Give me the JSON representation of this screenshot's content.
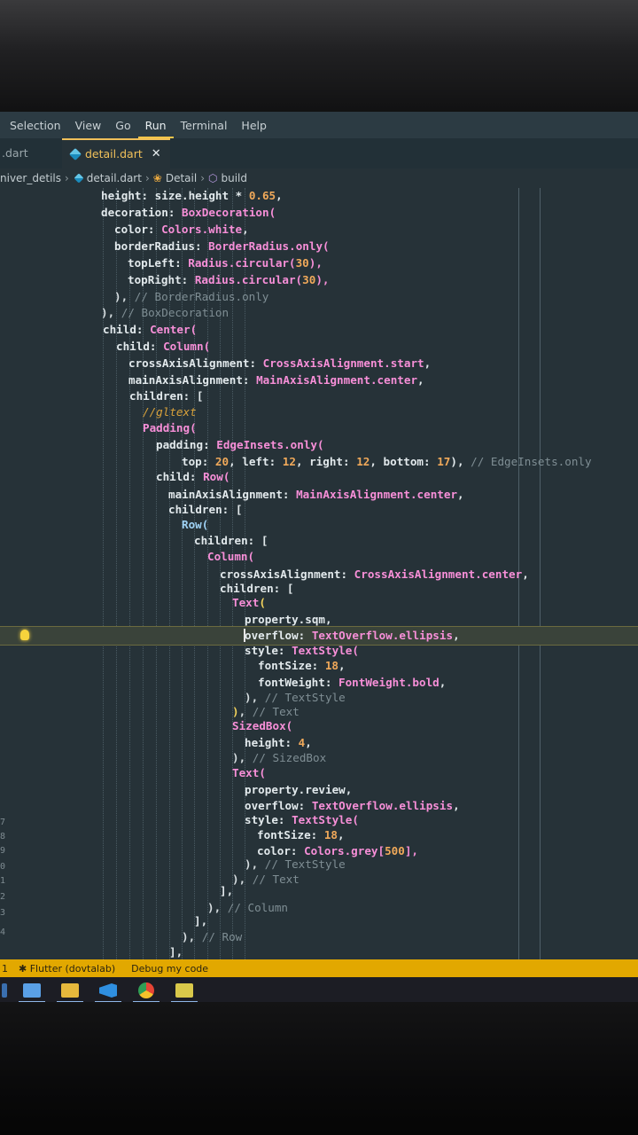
{
  "menu": [
    "Selection",
    "View",
    "Go",
    "Run",
    "Terminal",
    "Help"
  ],
  "menu_active": "Run",
  "tabs": [
    {
      "label": ".dart",
      "active": false
    },
    {
      "label": "detail.dart",
      "active": true,
      "close": "✕"
    }
  ],
  "breadcrumb": {
    "folder": "niver_detils",
    "file": "detail.dart",
    "class": "Detail",
    "method": "build",
    "sep": "›"
  },
  "gutter_numbers": [
    "7",
    "8",
    "9",
    "0",
    "1",
    "2",
    "3",
    "4"
  ],
  "code_lines": [
    [
      {
        "t": "height: size.height * ",
        "c": "prop"
      },
      {
        "t": "0.65",
        "c": "num"
      },
      {
        "t": ",",
        "c": "prop"
      }
    ],
    [
      {
        "t": "decoration: ",
        "c": "prop"
      },
      {
        "t": "BoxDecoration(",
        "c": "cls"
      }
    ],
    [
      {
        "t": "color: ",
        "c": "prop"
      },
      {
        "t": "Colors.white",
        "c": "cls"
      },
      {
        "t": ",",
        "c": "prop"
      }
    ],
    [
      {
        "t": "borderRadius: ",
        "c": "prop"
      },
      {
        "t": "BorderRadius.only(",
        "c": "cls"
      }
    ],
    [
      {
        "t": "topLeft: ",
        "c": "prop"
      },
      {
        "t": "Radius.circular(",
        "c": "cls"
      },
      {
        "t": "30",
        "c": "num"
      },
      {
        "t": "),",
        "c": "cls"
      }
    ],
    [
      {
        "t": "topRight: ",
        "c": "prop"
      },
      {
        "t": "Radius.circular(",
        "c": "cls"
      },
      {
        "t": "30",
        "c": "num"
      },
      {
        "t": "),",
        "c": "cls"
      }
    ],
    [
      {
        "t": "), ",
        "c": "brace"
      },
      {
        "t": "// BorderRadius.only",
        "c": "cmt"
      }
    ],
    [
      {
        "t": "), ",
        "c": "brace"
      },
      {
        "t": "// BoxDecoration",
        "c": "cmt"
      }
    ],
    [
      {
        "t": "child: ",
        "c": "prop"
      },
      {
        "t": "Center(",
        "c": "cls"
      }
    ],
    [
      {
        "t": "child: ",
        "c": "prop"
      },
      {
        "t": "Column(",
        "c": "cls"
      }
    ],
    [
      {
        "t": "crossAxisAlignment: ",
        "c": "prop"
      },
      {
        "t": "CrossAxisAlignment.start",
        "c": "cls"
      },
      {
        "t": ",",
        "c": "prop"
      }
    ],
    [
      {
        "t": "mainAxisAlignment: ",
        "c": "prop"
      },
      {
        "t": "MainAxisAlignment.center",
        "c": "cls"
      },
      {
        "t": ",",
        "c": "prop"
      }
    ],
    [
      {
        "t": "children: [",
        "c": "prop"
      }
    ],
    [
      {
        "t": "//gltext",
        "c": "it"
      }
    ],
    [
      {
        "t": "Padding(",
        "c": "cls"
      }
    ],
    [
      {
        "t": "padding: ",
        "c": "prop"
      },
      {
        "t": "EdgeInsets.only(",
        "c": "cls"
      }
    ],
    [
      {
        "t": "top: ",
        "c": "prop"
      },
      {
        "t": "20",
        "c": "num"
      },
      {
        "t": ", left: ",
        "c": "prop"
      },
      {
        "t": "12",
        "c": "num"
      },
      {
        "t": ", right: ",
        "c": "prop"
      },
      {
        "t": "12",
        "c": "num"
      },
      {
        "t": ", bottom: ",
        "c": "prop"
      },
      {
        "t": "17",
        "c": "num"
      },
      {
        "t": "), ",
        "c": "prop"
      },
      {
        "t": "// EdgeInsets.only",
        "c": "cmt"
      }
    ],
    [
      {
        "t": "child: ",
        "c": "prop"
      },
      {
        "t": "Row(",
        "c": "cls"
      }
    ],
    [
      {
        "t": "mainAxisAlignment: ",
        "c": "prop"
      },
      {
        "t": "MainAxisAlignment.center",
        "c": "cls"
      },
      {
        "t": ",",
        "c": "prop"
      }
    ],
    [
      {
        "t": "children: [",
        "c": "prop"
      }
    ],
    [
      {
        "t": "Row(",
        "c": "bl"
      }
    ],
    [
      {
        "t": "children: [",
        "c": "prop"
      }
    ],
    [
      {
        "t": "Column(",
        "c": "cls"
      }
    ],
    [
      {
        "t": "crossAxisAlignment: ",
        "c": "prop"
      },
      {
        "t": "CrossAxisAlignment.center",
        "c": "cls"
      },
      {
        "t": ",",
        "c": "prop"
      }
    ],
    [
      {
        "t": "children: [",
        "c": "prop"
      }
    ],
    [
      {
        "t": "Text",
        "c": "cls"
      },
      {
        "t": "(",
        "c": "yel"
      }
    ],
    [
      {
        "t": "property.sqm,",
        "c": "prop"
      }
    ],
    [
      {
        "t": "overflow: ",
        "c": "prop"
      },
      {
        "t": "TextOverflow.ellipsis",
        "c": "cls"
      },
      {
        "t": ",",
        "c": "prop"
      }
    ],
    [
      {
        "t": "style: ",
        "c": "prop"
      },
      {
        "t": "TextStyle(",
        "c": "cls"
      }
    ],
    [
      {
        "t": "fontSize: ",
        "c": "prop"
      },
      {
        "t": "18",
        "c": "num"
      },
      {
        "t": ",",
        "c": "prop"
      }
    ],
    [
      {
        "t": "fontWeight: ",
        "c": "prop"
      },
      {
        "t": "FontWeight.bold",
        "c": "cls"
      },
      {
        "t": ",",
        "c": "prop"
      }
    ],
    [
      {
        "t": "), ",
        "c": "brace"
      },
      {
        "t": "// TextStyle",
        "c": "cmt"
      }
    ],
    [
      {
        "t": ")",
        "c": "yel"
      },
      {
        "t": ", ",
        "c": "brace"
      },
      {
        "t": "// Text",
        "c": "cmt"
      }
    ],
    [
      {
        "t": "SizedBox(",
        "c": "cls"
      }
    ],
    [
      {
        "t": "height: ",
        "c": "prop"
      },
      {
        "t": "4",
        "c": "num"
      },
      {
        "t": ",",
        "c": "prop"
      }
    ],
    [
      {
        "t": "), ",
        "c": "brace"
      },
      {
        "t": "// SizedBox",
        "c": "cmt"
      }
    ],
    [
      {
        "t": "Text(",
        "c": "cls"
      }
    ],
    [
      {
        "t": "property.review,",
        "c": "prop"
      }
    ],
    [
      {
        "t": "overflow: ",
        "c": "prop"
      },
      {
        "t": "TextOverflow.ellipsis",
        "c": "cls"
      },
      {
        "t": ",",
        "c": "prop"
      }
    ],
    [
      {
        "t": "style: ",
        "c": "prop"
      },
      {
        "t": "TextStyle(",
        "c": "cls"
      }
    ],
    [
      {
        "t": "fontSize: ",
        "c": "prop"
      },
      {
        "t": "18",
        "c": "num"
      },
      {
        "t": ",",
        "c": "prop"
      }
    ],
    [
      {
        "t": "color: ",
        "c": "prop"
      },
      {
        "t": "Colors.grey[",
        "c": "cls"
      },
      {
        "t": "500",
        "c": "num"
      },
      {
        "t": "],",
        "c": "cls"
      }
    ],
    [
      {
        "t": "), ",
        "c": "brace"
      },
      {
        "t": "// TextStyle",
        "c": "cmt"
      }
    ],
    [
      {
        "t": "), ",
        "c": "brace"
      },
      {
        "t": "// Text",
        "c": "cmt"
      }
    ],
    [
      {
        "t": "],",
        "c": "prop"
      }
    ],
    [
      {
        "t": "), ",
        "c": "brace"
      },
      {
        "t": "// Column",
        "c": "cmt"
      }
    ],
    [
      {
        "t": "],",
        "c": "prop"
      }
    ],
    [
      {
        "t": "), ",
        "c": "brace"
      },
      {
        "t": "// Row",
        "c": "cmt"
      }
    ],
    [
      {
        "t": "],",
        "c": "prop"
      }
    ]
  ],
  "status": {
    "flutter": "Flutter (dovtalab)",
    "debug": "Debug my code"
  },
  "colors": {
    "editor_bg": "#263238",
    "status_bg": "#e2a800",
    "accent": "#f0c05a"
  }
}
